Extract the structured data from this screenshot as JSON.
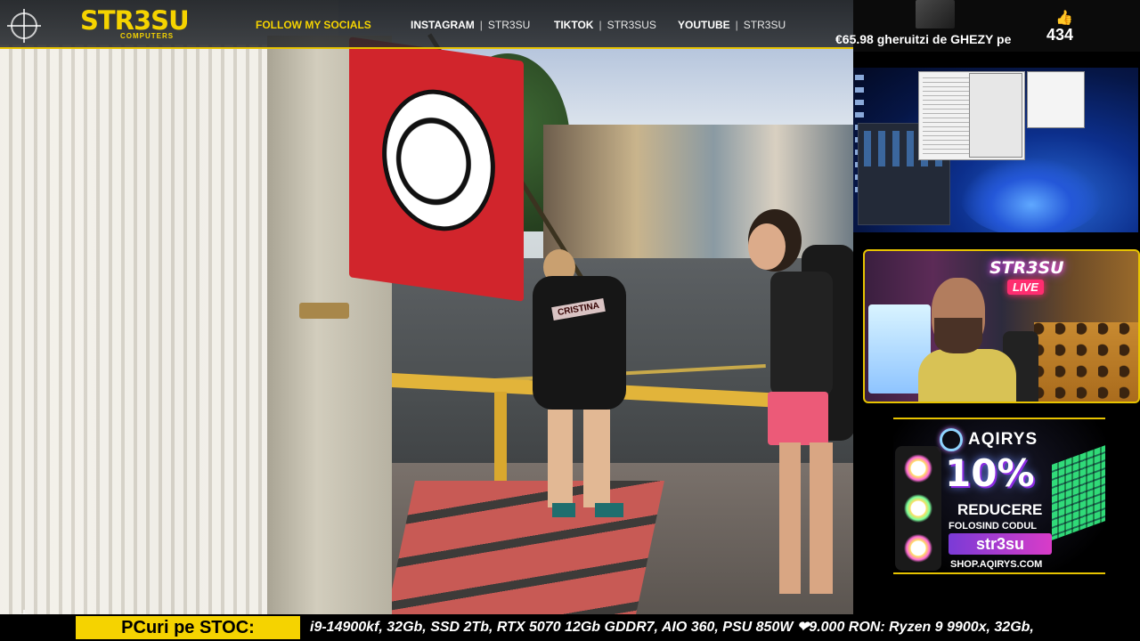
{
  "header": {
    "logo": {
      "main": "STR3SU",
      "sub": "COMPUTERS"
    },
    "follow_label": "FOLLOW MY SOCIALS",
    "socials": [
      {
        "name": "INSTAGRAM",
        "handle": "STR3SU"
      },
      {
        "name": "TIKTOK",
        "handle": "STR3SUS"
      },
      {
        "name": "YOUTUBE",
        "handle": "STR3SU"
      }
    ]
  },
  "video": {
    "backpack_tag": "CRISTINA"
  },
  "donation": {
    "text": "€65.98 gheruitzi de GHEZY pe",
    "like_icon": "thumbs-up-icon",
    "likes": "434"
  },
  "webcam": {
    "neon_sign": "STR3SU",
    "neon_live": "LIVE"
  },
  "ad": {
    "brand": "AQIRYS",
    "discount": "10%",
    "line1": "REDUCERE",
    "line2": "FOLOSIND CODUL",
    "code": "str3su",
    "url": "SHOP.AQIRYS.COM"
  },
  "ticker": {
    "label": "PCuri pe STOC:",
    "text": "i9-14900kf, 32Gb, SSD 2Tb, RTX 5070 12Gb GDDR7, AIO 360, PSU 850W ❤9.000 RON: Ryzen 9 9900x, 32Gb,"
  },
  "colors": {
    "accent": "#f5d300",
    "background": "#000000"
  }
}
